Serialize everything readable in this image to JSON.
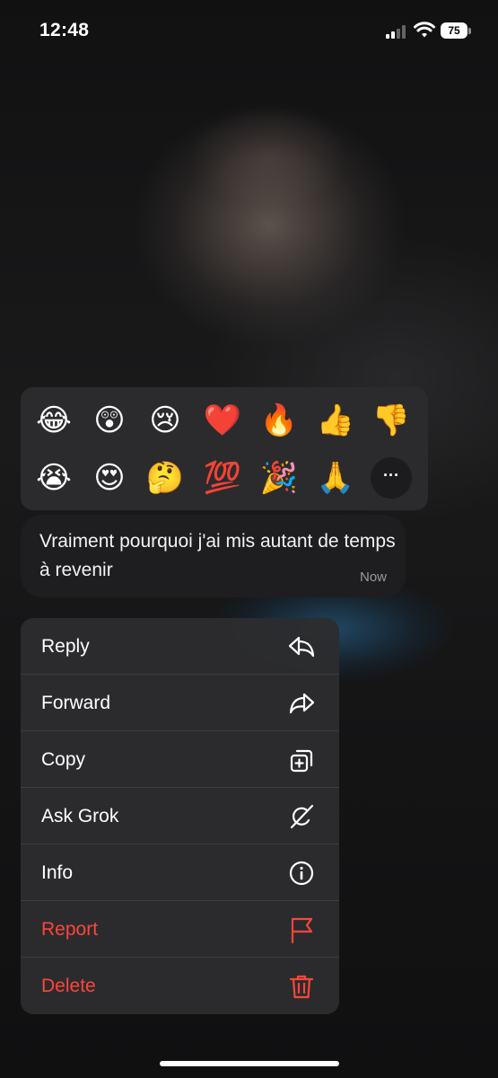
{
  "status_bar": {
    "time": "12:48",
    "battery": "75"
  },
  "reactions": {
    "row1": [
      "😂",
      "😲",
      "😢",
      "❤️",
      "🔥",
      "👍",
      "👎"
    ],
    "row2": [
      "😭",
      "😍",
      "🤔",
      "💯",
      "🎉",
      "🙏"
    ],
    "more_label": "···"
  },
  "message": {
    "text": "Vraiment pourquoi j'ai mis autant de temps à revenir",
    "time": "Now"
  },
  "menu": {
    "items": [
      {
        "label": "Reply",
        "icon": "reply-icon"
      },
      {
        "label": "Forward",
        "icon": "forward-icon"
      },
      {
        "label": "Copy",
        "icon": "copy-icon"
      },
      {
        "label": "Ask Grok",
        "icon": "grok-icon"
      },
      {
        "label": "Info",
        "icon": "info-icon"
      },
      {
        "label": "Report",
        "icon": "flag-icon",
        "color": "#ff453a"
      },
      {
        "label": "Delete",
        "icon": "trash-icon",
        "color": "#ff453a"
      }
    ]
  }
}
